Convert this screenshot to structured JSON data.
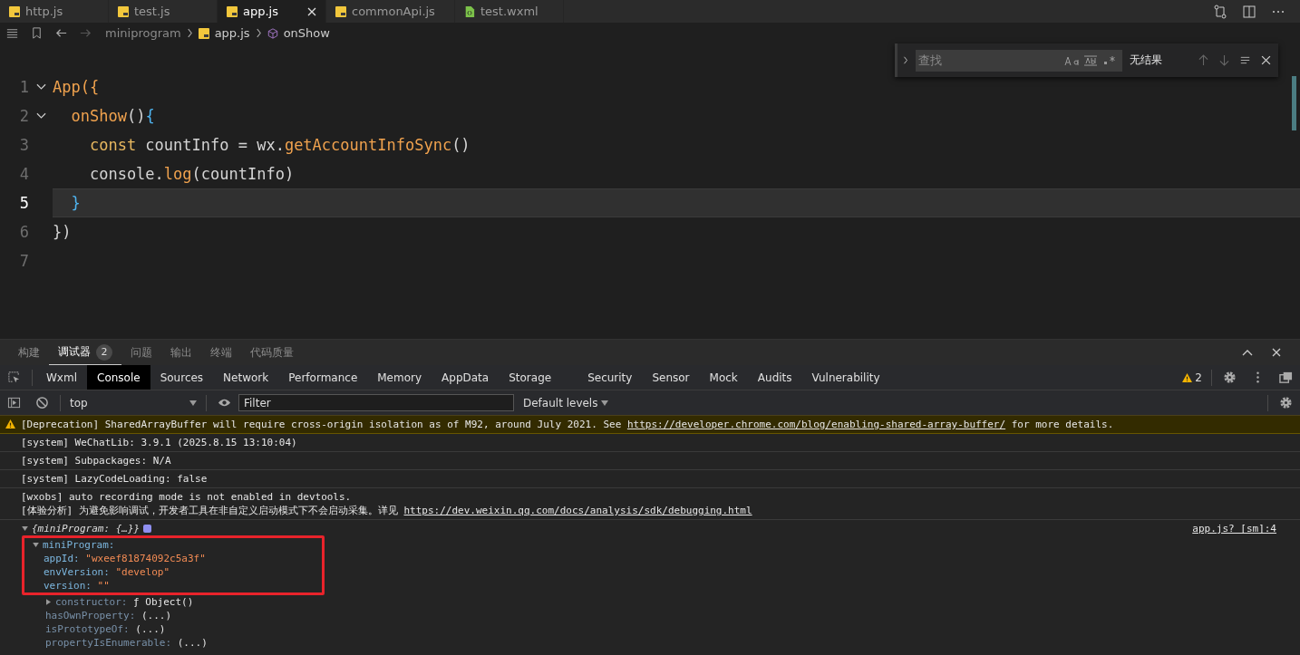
{
  "editor_tabs": [
    {
      "label": "http.js",
      "kind": "js",
      "selected": false
    },
    {
      "label": "test.js",
      "kind": "js",
      "selected": false
    },
    {
      "label": "app.js",
      "kind": "js",
      "selected": true
    },
    {
      "label": "commonApi.js",
      "kind": "js",
      "selected": false
    },
    {
      "label": "test.wxml",
      "kind": "wxml",
      "selected": false
    }
  ],
  "breadcrumb": [
    {
      "label": "miniprogram",
      "kind": "folder"
    },
    {
      "label": "app.js",
      "kind": "js"
    },
    {
      "label": "onShow",
      "kind": "symbol"
    }
  ],
  "code_lines": [
    {
      "number": "1",
      "foldable": true,
      "current": false,
      "tokens": [
        {
          "t": "App({",
          "kind": "fn"
        }
      ]
    },
    {
      "number": "2",
      "foldable": true,
      "current": false,
      "tokens": [
        {
          "t": "  onShow",
          "kind": "fn"
        },
        {
          "t": "()",
          "kind": "plain"
        },
        {
          "t": "{",
          "kind": "brace"
        }
      ]
    },
    {
      "number": "3",
      "foldable": false,
      "current": false,
      "tokens": [
        {
          "t": "    const",
          "kind": "kw"
        },
        {
          "t": " countInfo = wx.",
          "kind": "plain"
        },
        {
          "t": "getAccountInfoSync",
          "kind": "fn"
        },
        {
          "t": "()",
          "kind": "plain"
        }
      ]
    },
    {
      "number": "4",
      "foldable": false,
      "current": false,
      "tokens": [
        {
          "t": "    console.",
          "kind": "plain"
        },
        {
          "t": "log",
          "kind": "fn"
        },
        {
          "t": "(countInfo)",
          "kind": "plain"
        }
      ]
    },
    {
      "number": "5",
      "foldable": false,
      "current": true,
      "tokens": [
        {
          "t": "  }",
          "kind": "brace"
        }
      ]
    },
    {
      "number": "6",
      "foldable": false,
      "current": false,
      "tokens": [
        {
          "t": "})",
          "kind": "plain"
        }
      ]
    },
    {
      "number": "7",
      "foldable": false,
      "current": false
    }
  ],
  "find_widget": {
    "placeholder": "查找",
    "result": "无结果"
  },
  "panel_tabs": [
    {
      "label": "构建",
      "selected": false
    },
    {
      "label": "调试器",
      "selected": true,
      "badge": "2"
    },
    {
      "label": "问题",
      "selected": false
    },
    {
      "label": "输出",
      "selected": false
    },
    {
      "label": "终端",
      "selected": false
    },
    {
      "label": "代码质量",
      "selected": false
    }
  ],
  "devtools_tabs": [
    {
      "label": "Wxml",
      "selected": false
    },
    {
      "label": "Console",
      "selected": true
    },
    {
      "label": "Sources",
      "selected": false
    },
    {
      "label": "Network",
      "selected": false
    },
    {
      "label": "Performance",
      "selected": false
    },
    {
      "label": "Memory",
      "selected": false
    },
    {
      "label": "AppData",
      "selected": false
    },
    {
      "label": "Storage",
      "selected": false
    },
    {
      "label": "Security",
      "selected": false
    },
    {
      "label": "Sensor",
      "selected": false
    },
    {
      "label": "Mock",
      "selected": false
    },
    {
      "label": "Audits",
      "selected": false
    },
    {
      "label": "Vulnerability",
      "selected": false
    }
  ],
  "warning_count": "2",
  "console_toolbar": {
    "context": "top",
    "filter_placeholder": "Filter",
    "levels": "Default levels"
  },
  "messages": [
    {
      "kind": "warning",
      "lines": [
        [
          {
            "t": "[Deprecation] SharedArrayBuffer will require cross-origin isolation as of M92, around July 2021. See ",
            "link": false
          },
          {
            "t": "https://developer.chrome.com/blog/enabling-shared-array-buffer/",
            "link": true
          },
          {
            "t": " for more details.",
            "link": false
          }
        ]
      ]
    },
    {
      "kind": "log",
      "lines": [
        [
          {
            "t": "[system] WeChatLib: 3.9.1 (2025.8.15 13:10:04)",
            "link": false
          }
        ]
      ]
    },
    {
      "kind": "log",
      "lines": [
        [
          {
            "t": "[system] Subpackages: N/A",
            "link": false
          }
        ]
      ]
    },
    {
      "kind": "log",
      "lines": [
        [
          {
            "t": "[system] LazyCodeLoading: false",
            "link": false
          }
        ]
      ]
    },
    {
      "kind": "log",
      "lines": [
        [
          {
            "t": "[wxobs] auto recording mode is not enabled in devtools.",
            "link": false
          }
        ],
        [
          {
            "t": "[体验分析] 为避免影响调试，开发者工具在非自定义启动模式下不会启动采集。详见 ",
            "link": false
          },
          {
            "t": "https://dev.weixin.qq.com/docs/analysis/sdk/debugging.html",
            "link": true
          }
        ]
      ]
    }
  ],
  "object_log": {
    "summary": "{miniProgram: {…}}",
    "source": "app.js? [sm]:4",
    "highlighted": {
      "key": "miniProgram:",
      "expanded": true,
      "children": [
        {
          "key": "appId:",
          "value": "\"wxeef81874092c5a3f\"",
          "kind": "string"
        },
        {
          "key": "envVersion:",
          "value": "\"develop\"",
          "kind": "string"
        },
        {
          "key": "version:",
          "value": "\"\"",
          "kind": "string"
        }
      ]
    },
    "members": [
      {
        "key": "constructor:",
        "value": "ƒ Object()",
        "expandable": true
      },
      {
        "key": "hasOwnProperty:",
        "value": "(...)",
        "expandable": false
      },
      {
        "key": "isPrototypeOf:",
        "value": "(...)",
        "expandable": false
      },
      {
        "key": "propertyIsEnumerable:",
        "value": "(...)",
        "expandable": false
      }
    ]
  }
}
